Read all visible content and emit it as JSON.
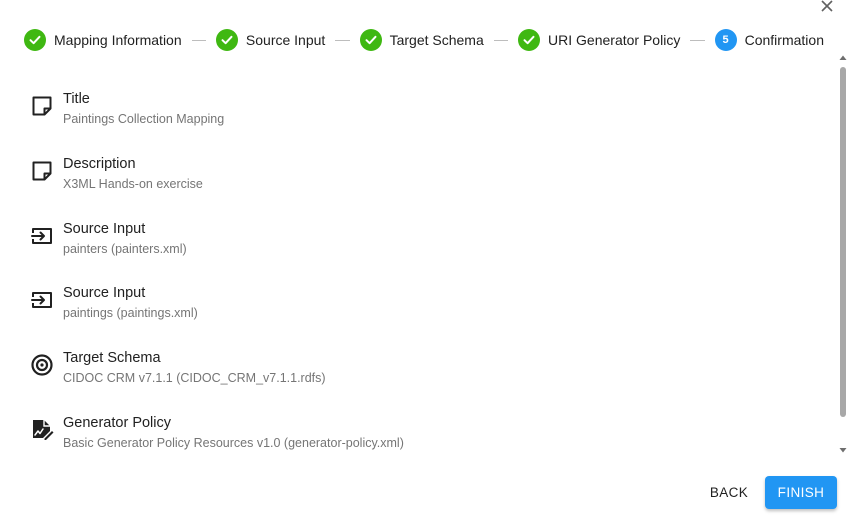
{
  "dialog": {
    "close_icon": "close-icon"
  },
  "stepper": {
    "steps": [
      {
        "label": "Mapping Information",
        "state": "completed",
        "icon": "check-circle-icon"
      },
      {
        "label": "Source Input",
        "state": "completed",
        "icon": "check-circle-icon"
      },
      {
        "label": "Target Schema",
        "state": "completed",
        "icon": "check-circle-icon"
      },
      {
        "label": "URI Generator Policy",
        "state": "completed",
        "icon": "check-circle-icon"
      },
      {
        "label": "Confirmation",
        "state": "active",
        "number": "5"
      }
    ],
    "completed_color": "#3fb812",
    "active_color": "#2196f3"
  },
  "summary": {
    "items": [
      {
        "title": "Title",
        "value": "Paintings Collection Mapping",
        "icon": "note-icon"
      },
      {
        "title": "Description",
        "value": "X3ML Hands-on exercise",
        "icon": "note-icon"
      },
      {
        "title": "Source Input",
        "value": "painters (painters.xml)",
        "icon": "input-icon"
      },
      {
        "title": "Source Input",
        "value": "paintings (paintings.xml)",
        "icon": "input-icon"
      },
      {
        "title": "Target Schema",
        "value": "CIDOC CRM v7.1.1 (CIDOC_CRM_v7.1.1.rdfs)",
        "icon": "target-icon"
      },
      {
        "title": "Generator Policy",
        "value": "Basic Generator Policy Resources v1.0 (generator-policy.xml)",
        "icon": "signature-icon"
      }
    ]
  },
  "actions": {
    "back_label": "BACK",
    "finish_label": "FINISH",
    "primary_color": "#2196f3"
  }
}
